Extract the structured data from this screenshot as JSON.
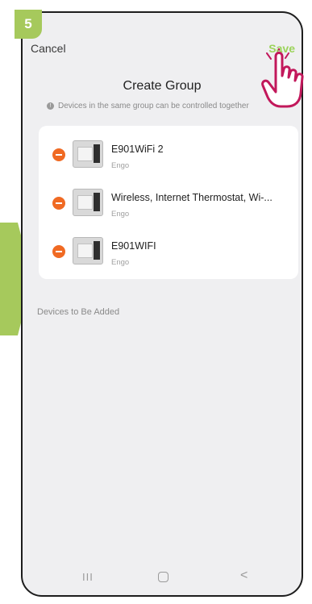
{
  "step": {
    "number": "5"
  },
  "header": {
    "cancel_label": "Cancel",
    "title": "Create Group",
    "save_label": "Save"
  },
  "info": {
    "text": "Devices in the same group can be controlled together"
  },
  "devices": [
    {
      "name": "E901WiFi 2",
      "brand": "Engo"
    },
    {
      "name": "Wireless, Internet Thermostat, Wi-...",
      "brand": "Engo"
    },
    {
      "name": "E901WIFI",
      "brand": "Engo"
    }
  ],
  "section_label": "Devices to Be Added",
  "nav": {
    "recent": "III",
    "back": "<"
  },
  "colors": {
    "accent_green": "#a6c95c",
    "save_green": "#9bd35a",
    "remove_orange": "#f06a23",
    "hand_magenta": "#c2185b"
  },
  "icons": [
    "remove-icon",
    "thermostat-icon",
    "info-icon",
    "pointer-hand-icon"
  ]
}
